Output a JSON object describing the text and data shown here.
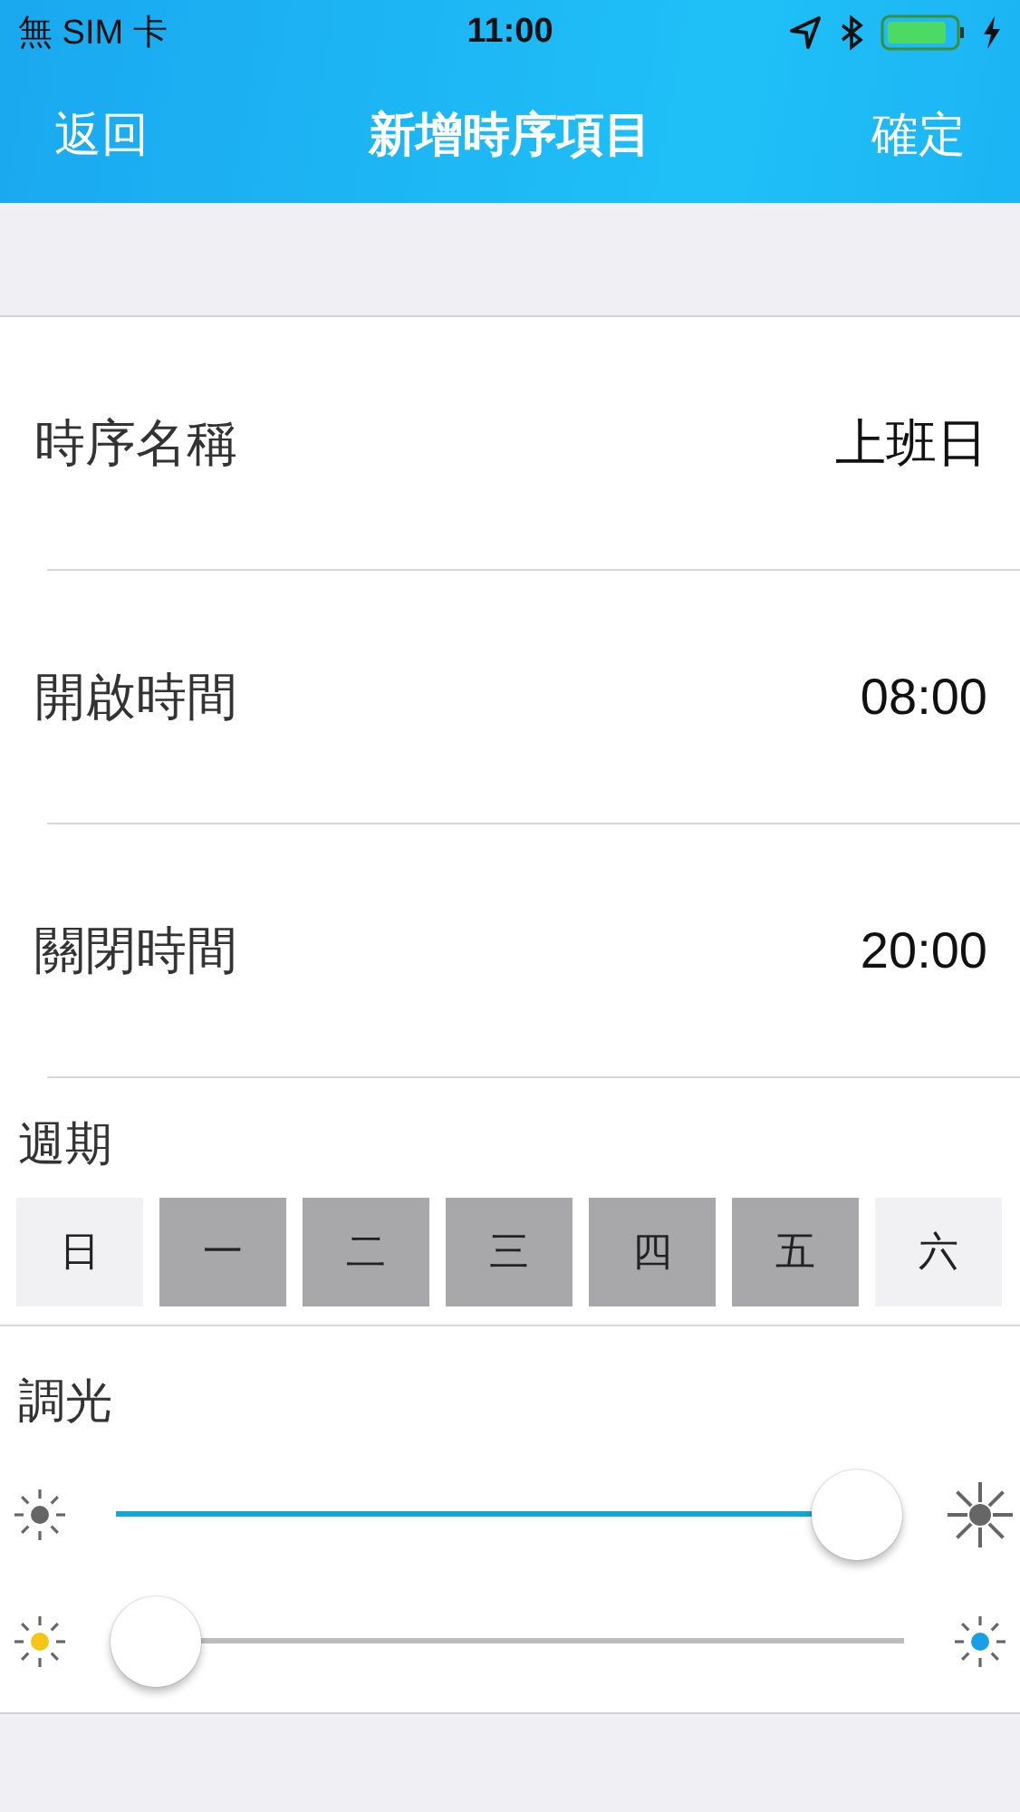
{
  "status_bar": {
    "carrier": "無 SIM 卡",
    "time": "11:00"
  },
  "nav": {
    "back": "返回",
    "title": "新增時序項目",
    "confirm": "確定"
  },
  "rows": [
    {
      "label": "時序名稱",
      "value": "上班日"
    },
    {
      "label": "開啟時間",
      "value": "08:00"
    },
    {
      "label": "關閉時間",
      "value": "20:00"
    }
  ],
  "schedule": {
    "title": "週期",
    "days": [
      {
        "label": "日",
        "selected": false
      },
      {
        "label": "一",
        "selected": true
      },
      {
        "label": "二",
        "selected": true
      },
      {
        "label": "三",
        "selected": true
      },
      {
        "label": "四",
        "selected": true
      },
      {
        "label": "五",
        "selected": true
      },
      {
        "label": "六",
        "selected": false
      }
    ]
  },
  "dimming": {
    "title": "調光",
    "sliders": [
      {
        "kind": "brightness",
        "level": 0.94
      },
      {
        "kind": "color-temperature",
        "level": 0.05
      }
    ]
  }
}
